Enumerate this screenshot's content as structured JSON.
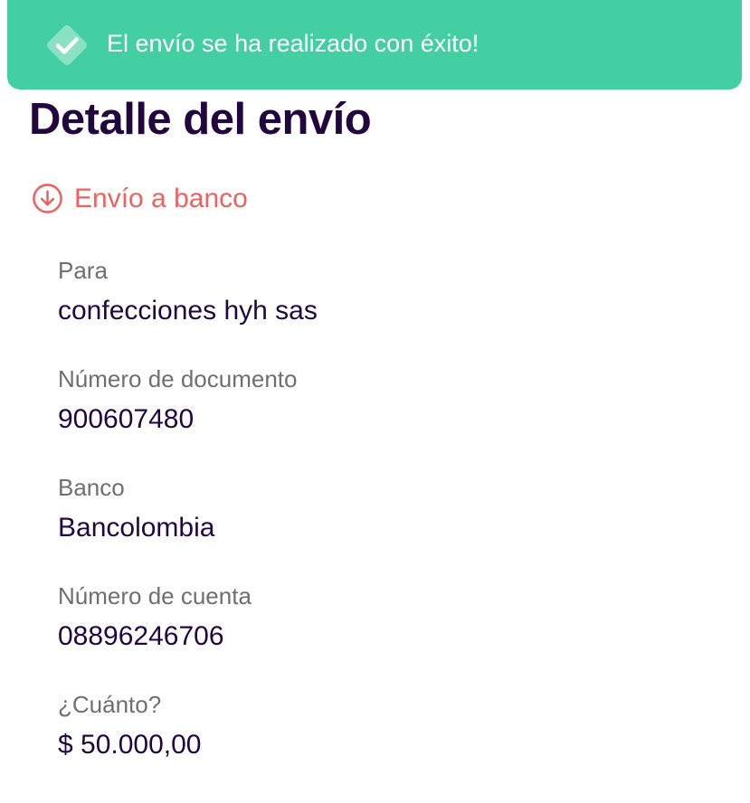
{
  "toast": {
    "icon": "check-diamond-icon",
    "message": "El envío se ha realizado con éxito!",
    "background": "#43cfa1"
  },
  "page": {
    "title": "Detalle del envío"
  },
  "transfer_type": {
    "icon": "arrow-down-circle-icon",
    "label": "Envío a banco",
    "color": "#ee6161"
  },
  "fields": [
    {
      "label": "Para",
      "value": "confecciones hyh sas"
    },
    {
      "label": "Número de documento",
      "value": "900607480"
    },
    {
      "label": "Banco",
      "value": "Bancolombia"
    },
    {
      "label": "Número de cuenta",
      "value": "08896246706"
    },
    {
      "label": "¿Cuánto?",
      "value": "$ 50.000,00"
    }
  ],
  "colors": {
    "text_primary": "#22073f",
    "text_secondary": "#6f6f6f"
  }
}
